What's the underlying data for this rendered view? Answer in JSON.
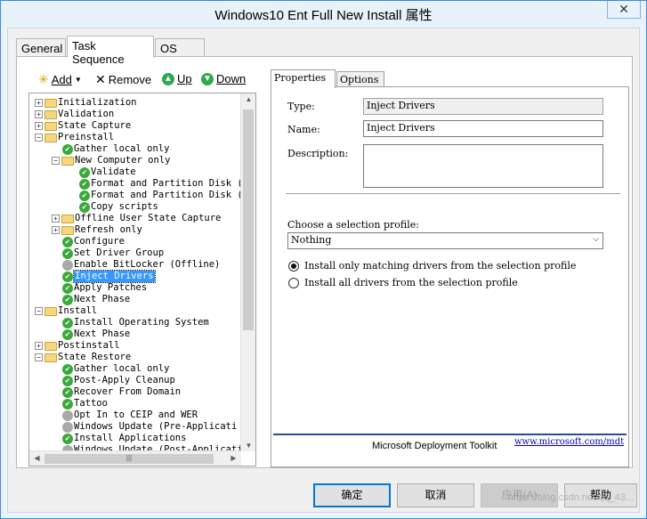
{
  "window": {
    "title": "Windows10 Ent Full New Install 属性",
    "close_glyph": "✕"
  },
  "tabs": [
    {
      "label": "General"
    },
    {
      "label": "Task Sequence"
    },
    {
      "label": "OS Info"
    }
  ],
  "toolbar": {
    "add": "Add",
    "remove": "Remove",
    "up": "Up",
    "down": "Down"
  },
  "tree": {
    "items": [
      {
        "label": "Initialization",
        "level": 0,
        "icon": "folder",
        "expander": "+"
      },
      {
        "label": "Validation",
        "level": 0,
        "icon": "folder",
        "expander": "+"
      },
      {
        "label": "State Capture",
        "level": 0,
        "icon": "folder",
        "expander": "+"
      },
      {
        "label": "Preinstall",
        "level": 0,
        "icon": "folder",
        "expander": "-"
      },
      {
        "label": "Gather local only",
        "level": 1,
        "icon": "check"
      },
      {
        "label": "New Computer only",
        "level": 1,
        "icon": "folder",
        "expander": "-"
      },
      {
        "label": "Validate",
        "level": 2,
        "icon": "check"
      },
      {
        "label": "Format and Partition Disk (",
        "level": 2,
        "icon": "check"
      },
      {
        "label": "Format and Partition Disk (",
        "level": 2,
        "icon": "check"
      },
      {
        "label": "Copy scripts",
        "level": 2,
        "icon": "check"
      },
      {
        "label": "Offline User State Capture",
        "level": 1,
        "icon": "folder",
        "expander": "+"
      },
      {
        "label": "Refresh only",
        "level": 1,
        "icon": "folder",
        "expander": "+"
      },
      {
        "label": "Configure",
        "level": 1,
        "icon": "check"
      },
      {
        "label": "Set Driver Group",
        "level": 1,
        "icon": "check"
      },
      {
        "label": "Enable BitLocker (Offline)",
        "level": 1,
        "icon": "grey"
      },
      {
        "label": "Inject Drivers",
        "level": 1,
        "icon": "check",
        "selected": true
      },
      {
        "label": "Apply Patches",
        "level": 1,
        "icon": "check"
      },
      {
        "label": "Next Phase",
        "level": 1,
        "icon": "check"
      },
      {
        "label": "Install",
        "level": 0,
        "icon": "folder",
        "expander": "-"
      },
      {
        "label": "Install Operating System",
        "level": 1,
        "icon": "check"
      },
      {
        "label": "Next Phase",
        "level": 1,
        "icon": "check"
      },
      {
        "label": "Postinstall",
        "level": 0,
        "icon": "folder",
        "expander": "+"
      },
      {
        "label": "State Restore",
        "level": 0,
        "icon": "folder",
        "expander": "-"
      },
      {
        "label": "Gather local only",
        "level": 1,
        "icon": "check"
      },
      {
        "label": "Post-Apply Cleanup",
        "level": 1,
        "icon": "check"
      },
      {
        "label": "Recover From Domain",
        "level": 1,
        "icon": "check"
      },
      {
        "label": "Tattoo",
        "level": 1,
        "icon": "check"
      },
      {
        "label": "Opt In to CEIP and WER",
        "level": 1,
        "icon": "grey"
      },
      {
        "label": "Windows Update (Pre-Applicati",
        "level": 1,
        "icon": "grey"
      },
      {
        "label": "Install Applications",
        "level": 1,
        "icon": "check"
      },
      {
        "label": "Windows Update (Post-Applicati",
        "level": 1,
        "icon": "grey"
      }
    ]
  },
  "right_tabs": [
    {
      "label": "Properties"
    },
    {
      "label": "Options"
    }
  ],
  "properties": {
    "type_label": "Type:",
    "type_value": "Inject Drivers",
    "name_label": "Name:",
    "name_value": "Inject Drivers",
    "description_label": "Description:",
    "description_value": "",
    "profile_label": "Choose a selection profile:",
    "profile_value": "Nothing",
    "radio_matching": "Install only matching drivers from the selection profile",
    "radio_all": "Install all drivers from the selection profile",
    "radio_selected": "matching"
  },
  "footer": {
    "brand": "Microsoft Deployment Toolkit",
    "link": "www.microsoft.com/mdt"
  },
  "buttons": {
    "ok": "确定",
    "cancel": "取消",
    "apply": "应用(A)",
    "help": "帮助"
  },
  "watermark": "https://blog.csdn.net/qq_43..."
}
